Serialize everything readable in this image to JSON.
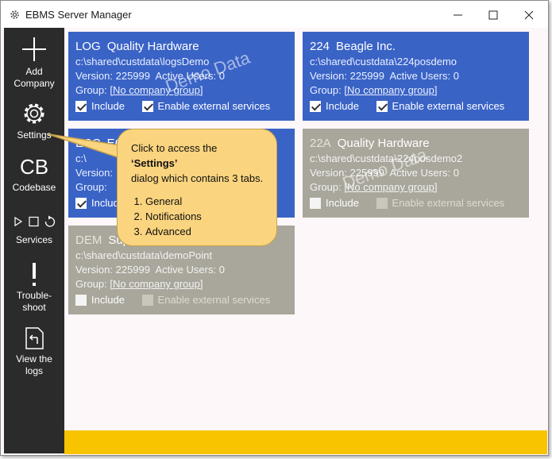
{
  "window": {
    "title": "EBMS Server Manager"
  },
  "sidebar": {
    "add_company": [
      "Add",
      "Company"
    ],
    "settings": "Settings",
    "codebase_icon": "CB",
    "codebase": "Codebase",
    "services": "Services",
    "troubleshoot": [
      "Trouble-",
      "shoot"
    ],
    "view_logs": [
      "View the",
      "logs"
    ]
  },
  "labels": {
    "version": "Version:",
    "active_users": "Active Users:",
    "group": "Group:",
    "include": "Include",
    "external": "Enable external services",
    "watermark": "Demo Data"
  },
  "companies": [
    {
      "code": "LOG",
      "name": "Quality Hardware",
      "path": "c:\\shared\\custdata\\logsDemo",
      "version": "225999",
      "users": "0",
      "group": "[No company group]",
      "include": true,
      "external": true
    },
    {
      "code": "224",
      "name": "Beagle Inc.",
      "path": "c:\\shared\\custdata\\224posdemo",
      "version": "225999",
      "users": "0",
      "group": "[No company group]",
      "include": true,
      "external": true
    },
    {
      "code": "ECC",
      "name": "EC",
      "path": "c:\\",
      "version": "",
      "users": "",
      "group": "",
      "include": true,
      "external": false
    },
    {
      "code": "22A",
      "name": "Quality Hardware",
      "path": "c:\\shared\\custdata\\224posdemo2",
      "version": "225999",
      "users": "0",
      "group": "[No company group]",
      "include": false,
      "external": false
    },
    {
      "code": "DEM",
      "name": "Sup",
      "path": "c:\\shared\\custdata\\demoPoint",
      "version": "225999",
      "users": "0",
      "group": "[No company group]",
      "include": false,
      "external": false
    }
  ],
  "callout": {
    "intro_pre": "Click to access the ",
    "intro_bold": "‘Settings’",
    "intro_post": "dialog which contains 3 tabs.",
    "tabs": [
      "General",
      "Notifications",
      "Advanced"
    ]
  },
  "colors": {
    "active_card": "#3a63c6",
    "inactive_card": "#a9a69b",
    "sidebar": "#2b2b2b",
    "footer": "#f8c400",
    "callout": "#fad47e"
  }
}
